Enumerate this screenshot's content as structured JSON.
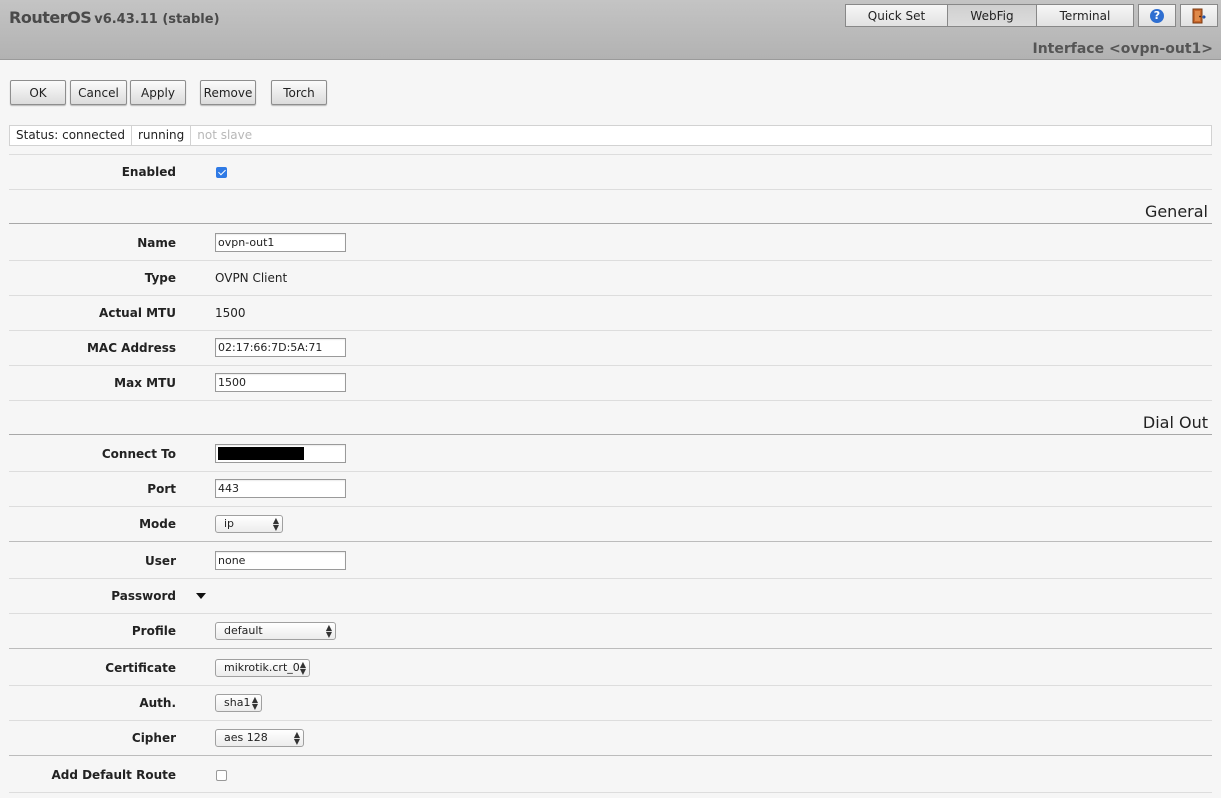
{
  "header": {
    "brand_name": "RouterOS",
    "brand_version": "v6.43.11 (stable)",
    "nav": [
      "Quick Set",
      "WebFig",
      "Terminal"
    ],
    "active_nav": "WebFig",
    "help_icon": "help-icon",
    "logout_icon": "logout-door-icon",
    "window_title": "Interface <ovpn-out1>"
  },
  "toolbar": {
    "ok": "OK",
    "cancel": "Cancel",
    "apply": "Apply",
    "remove": "Remove",
    "torch": "Torch"
  },
  "status": {
    "state": "Status: connected",
    "running": "running",
    "slave": "not slave"
  },
  "enabled": {
    "label": "Enabled",
    "checked": true
  },
  "general": {
    "title": "General",
    "name_label": "Name",
    "name_value": "ovpn-out1",
    "type_label": "Type",
    "type_value": "OVPN Client",
    "actual_mtu_label": "Actual MTU",
    "actual_mtu_value": "1500",
    "mac_label": "MAC Address",
    "mac_value": "02:17:66:7D:5A:71",
    "max_mtu_label": "Max MTU",
    "max_mtu_value": "1500"
  },
  "dial_out": {
    "title": "Dial Out",
    "connect_to_label": "Connect To",
    "port_label": "Port",
    "port_value": "443",
    "mode_label": "Mode",
    "mode_value": "ip",
    "user_label": "User",
    "user_value": "none",
    "password_label": "Password",
    "profile_label": "Profile",
    "profile_value": "default",
    "certificate_label": "Certificate",
    "certificate_value": "mikrotik.crt_0",
    "auth_label": "Auth.",
    "auth_value": "sha1",
    "cipher_label": "Cipher",
    "cipher_value": "aes 128",
    "default_route_label": "Add Default Route",
    "default_route_checked": false
  },
  "colors": {
    "accent": "#2f7ae5",
    "topbar": "#b8b8b8"
  }
}
